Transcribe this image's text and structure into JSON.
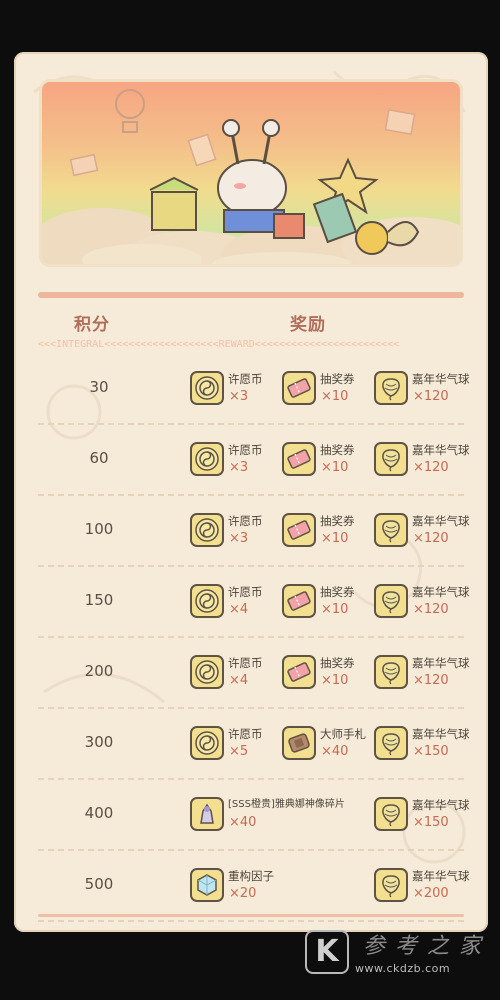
{
  "headers": {
    "score": "积分",
    "reward": "奖励",
    "sub": "<<<INTEGRAL<<<<<<<<<<<<<<<<<<<REWARD<<<<<<<<<<<<<<<<<<<<<<<<"
  },
  "icons": {
    "coin": "wish-coin-icon",
    "ticket": "lottery-ticket-icon",
    "balloon": "carnival-balloon-icon",
    "manual": "master-manual-scroll-icon",
    "fragment": "statue-fragment-icon",
    "factor": "rebuild-factor-cube-icon"
  },
  "rows": [
    {
      "score": "30",
      "rewards": [
        {
          "icon": "coin",
          "name": "许愿币",
          "count": "×3"
        },
        {
          "icon": "ticket",
          "name": "抽奖券",
          "count": "×10"
        },
        {
          "icon": "balloon",
          "name": "嘉年华气球",
          "count": "×120"
        }
      ]
    },
    {
      "score": "60",
      "rewards": [
        {
          "icon": "coin",
          "name": "许愿币",
          "count": "×3"
        },
        {
          "icon": "ticket",
          "name": "抽奖券",
          "count": "×10"
        },
        {
          "icon": "balloon",
          "name": "嘉年华气球",
          "count": "×120"
        }
      ]
    },
    {
      "score": "100",
      "rewards": [
        {
          "icon": "coin",
          "name": "许愿币",
          "count": "×3"
        },
        {
          "icon": "ticket",
          "name": "抽奖券",
          "count": "×10"
        },
        {
          "icon": "balloon",
          "name": "嘉年华气球",
          "count": "×120"
        }
      ]
    },
    {
      "score": "150",
      "rewards": [
        {
          "icon": "coin",
          "name": "许愿币",
          "count": "×4"
        },
        {
          "icon": "ticket",
          "name": "抽奖券",
          "count": "×10"
        },
        {
          "icon": "balloon",
          "name": "嘉年华气球",
          "count": "×120"
        }
      ]
    },
    {
      "score": "200",
      "rewards": [
        {
          "icon": "coin",
          "name": "许愿币",
          "count": "×4"
        },
        {
          "icon": "ticket",
          "name": "抽奖券",
          "count": "×10"
        },
        {
          "icon": "balloon",
          "name": "嘉年华气球",
          "count": "×120"
        }
      ]
    },
    {
      "score": "300",
      "rewards": [
        {
          "icon": "coin",
          "name": "许愿币",
          "count": "×5"
        },
        {
          "icon": "manual",
          "name": "大师手札",
          "count": "×40"
        },
        {
          "icon": "balloon",
          "name": "嘉年华气球",
          "count": "×150"
        }
      ]
    },
    {
      "score": "400",
      "rewards": [
        {
          "icon": "fragment",
          "name": "[SSS橙贵]雅典娜神像碎片",
          "count": "×40"
        },
        null,
        {
          "icon": "balloon",
          "name": "嘉年华气球",
          "count": "×150"
        }
      ]
    },
    {
      "score": "500",
      "rewards": [
        {
          "icon": "factor",
          "name": "重构因子",
          "count": "×20"
        },
        null,
        {
          "icon": "balloon",
          "name": "嘉年华气球",
          "count": "×200"
        }
      ]
    }
  ],
  "watermark": {
    "logo": "K",
    "cn": "参考之家",
    "url": "www.ckdzb.com"
  },
  "colors": {
    "panel": "#f6ebd8",
    "accent": "#c66a54",
    "header": "#b06f5c",
    "icon_bg": "#f2df8f"
  }
}
